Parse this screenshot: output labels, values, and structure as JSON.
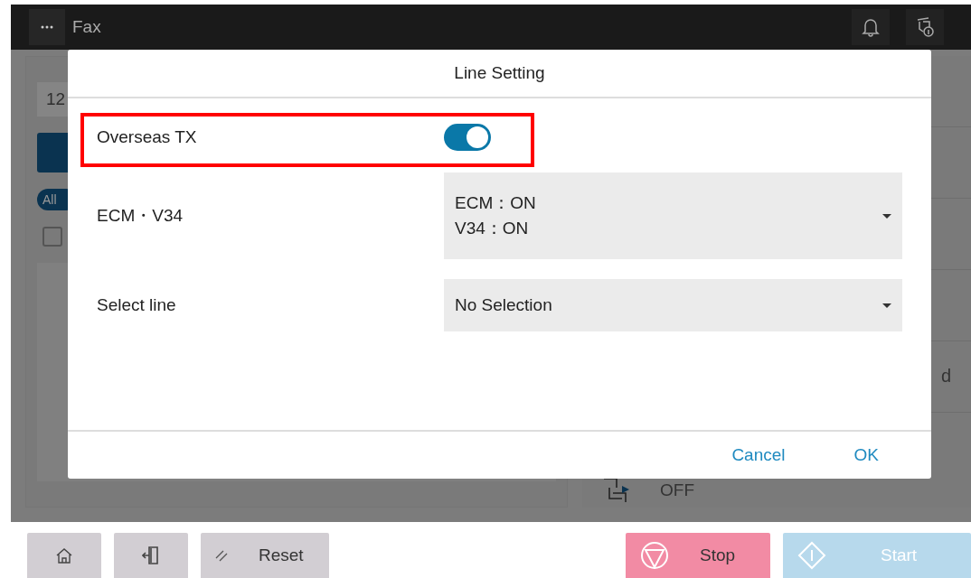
{
  "header": {
    "title": "Fax"
  },
  "background": {
    "field_text": "12",
    "filter_chip": "All",
    "checkbox_checked": false,
    "side_text": "d",
    "status_text": "OFF"
  },
  "dialog": {
    "title": "Line Setting",
    "rows": [
      {
        "kind": "toggle",
        "label": "Overseas TX",
        "on": true,
        "highlighted": true
      },
      {
        "kind": "dropdown",
        "label": "ECM・V34",
        "value": [
          "ECM：ON",
          "V34：ON"
        ],
        "highlighted": false
      },
      {
        "kind": "dropdown",
        "label": "Select line",
        "value": [
          "No Selection"
        ],
        "highlighted": false
      }
    ],
    "buttons": [
      "Cancel",
      "OK"
    ]
  },
  "footer": {
    "reset": "Reset",
    "stop": "Stop",
    "start": "Start"
  }
}
